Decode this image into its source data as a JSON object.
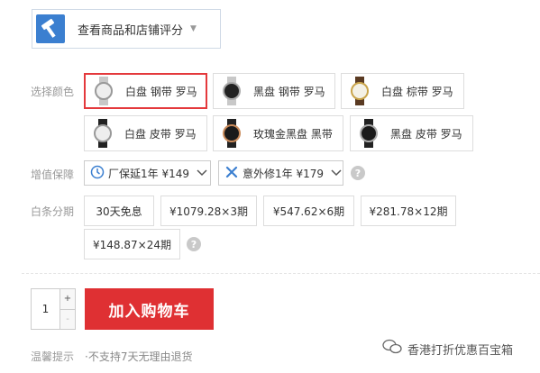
{
  "header": {
    "score_button_label": "查看商品和店铺评分"
  },
  "color": {
    "label": "选择颜色",
    "options": [
      {
        "label": "白盘 钢带 罗马",
        "face": "white",
        "strap": "steel",
        "selected": true
      },
      {
        "label": "黑盘 钢带 罗马",
        "face": "black",
        "strap": "steel",
        "selected": false
      },
      {
        "label": "白盘 棕带 罗马",
        "face": "white",
        "strap": "brown",
        "selected": false
      },
      {
        "label": "白盘 皮带 罗马",
        "face": "white",
        "strap": "black",
        "selected": false
      },
      {
        "label": "玫瑰金黑盘 黑带",
        "face": "black",
        "strap": "black",
        "selected": false
      },
      {
        "label": "黑盘 皮带 罗马",
        "face": "black",
        "strap": "black",
        "selected": false
      }
    ]
  },
  "service": {
    "label": "增值保障",
    "warranty": "厂保延1年 ¥149",
    "accident": "意外修1年 ¥179"
  },
  "installment": {
    "label": "白条分期",
    "options": [
      "30天免息",
      "¥1079.28×3期",
      "¥547.62×6期",
      "¥281.78×12期",
      "¥148.87×24期"
    ]
  },
  "purchase": {
    "quantity": "1",
    "plus": "+",
    "minus": "-",
    "add_to_cart": "加入购物车"
  },
  "tip": {
    "label": "温馨提示",
    "text": "·不支持7天无理由退货"
  },
  "watermark": "香港打折优惠百宝箱",
  "colors": {
    "accent": "#df3033",
    "logo_blue": "#3b7fd0"
  }
}
